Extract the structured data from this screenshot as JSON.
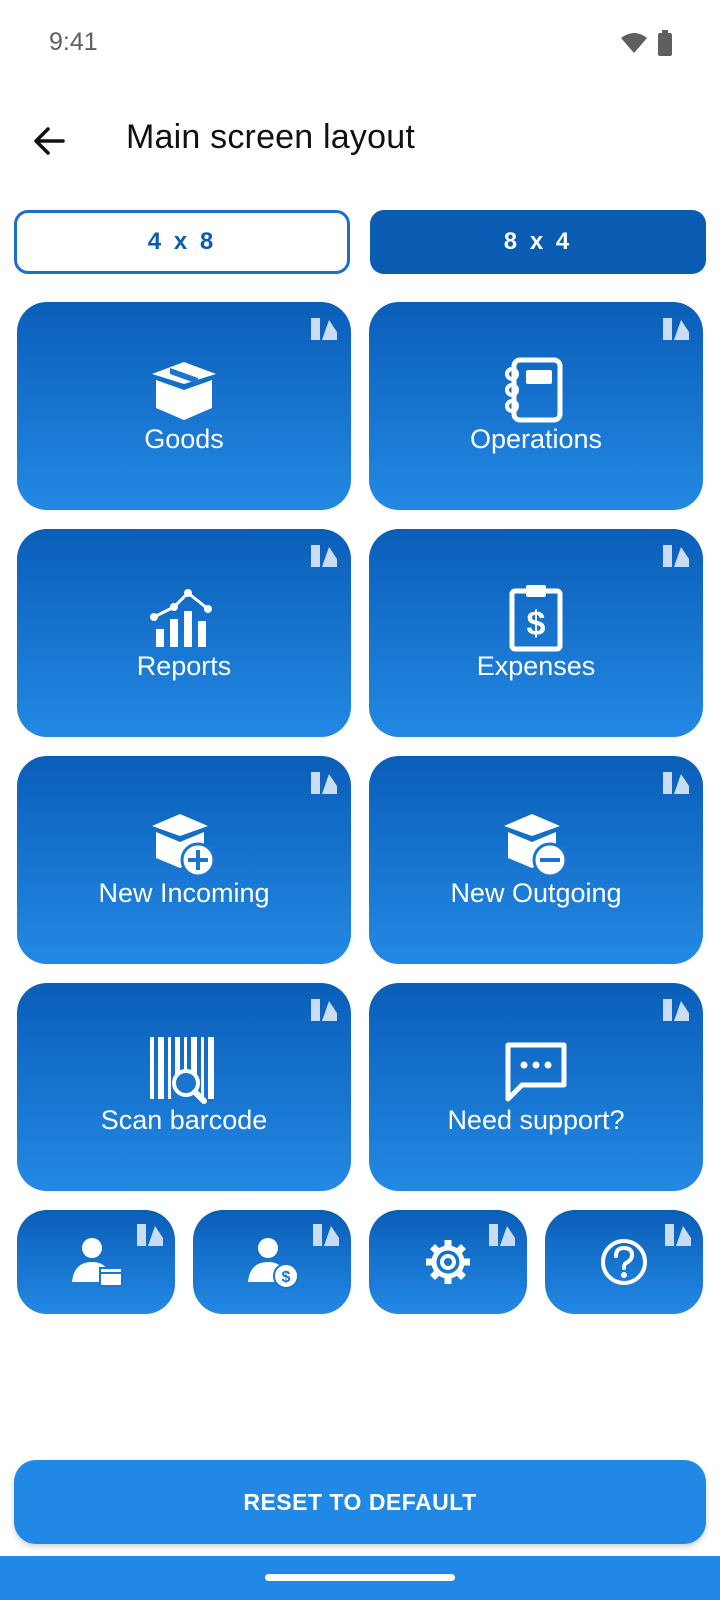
{
  "status": {
    "time": "9:41"
  },
  "header": {
    "title": "Main screen layout"
  },
  "layout_toggle": {
    "options": [
      "4 x 8",
      "8 x 4"
    ],
    "selected": "8 x 4"
  },
  "tiles": [
    {
      "label": "Goods",
      "icon": "box-icon"
    },
    {
      "label": "Operations",
      "icon": "notebook-icon"
    },
    {
      "label": "Reports",
      "icon": "bar-chart-icon"
    },
    {
      "label": "Expenses",
      "icon": "clipboard-dollar-icon"
    },
    {
      "label": "New Incoming",
      "icon": "box-plus-icon"
    },
    {
      "label": "New Outgoing",
      "icon": "box-minus-icon"
    },
    {
      "label": "Scan barcode",
      "icon": "barcode-search-icon"
    },
    {
      "label": "Need support?",
      "icon": "chat-icon"
    }
  ],
  "small_tiles": [
    {
      "icon": "user-box-icon"
    },
    {
      "icon": "user-dollar-icon"
    },
    {
      "icon": "gear-icon"
    },
    {
      "icon": "help-circle-icon"
    }
  ],
  "actions": {
    "reset_label": "RESET TO DEFAULT"
  },
  "colors": {
    "accent": "#2288e6",
    "tile_top": "#0a5eb8",
    "tile_bottom": "#2389e4"
  }
}
